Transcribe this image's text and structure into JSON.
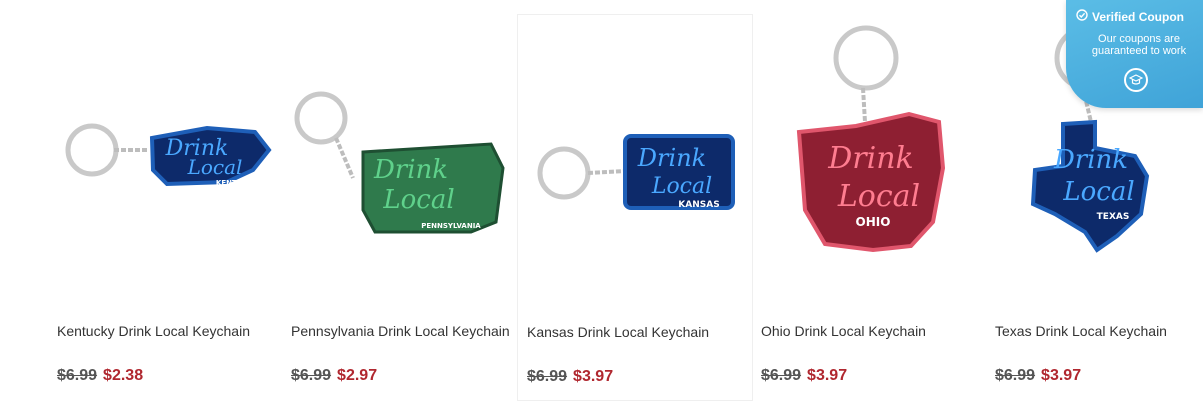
{
  "products": [
    {
      "title": "Kentucky Drink Local Keychain",
      "old_price": "$6.99",
      "new_price": "$2.38",
      "tag": "KENTUCKY"
    },
    {
      "title": "Pennsylvania Drink Local Keychain",
      "old_price": "$6.99",
      "new_price": "$2.97",
      "tag": "PENNSYLVANIA"
    },
    {
      "title": "Kansas Drink Local Keychain",
      "old_price": "$6.99",
      "new_price": "$3.97",
      "tag": "KANSAS"
    },
    {
      "title": "Ohio Drink Local Keychain",
      "old_price": "$6.99",
      "new_price": "$3.97",
      "tag": "OHIO"
    },
    {
      "title": "Texas Drink Local Keychain",
      "old_price": "$6.99",
      "new_price": "$3.97",
      "tag": "TEXAS"
    }
  ],
  "keychain_art": {
    "line1": "Drink",
    "line2": "Local"
  },
  "coupon": {
    "title": "Verified Coupon",
    "subtitle": "Our coupons are guaranteed to work",
    "icon": "graduation-cap-icon"
  },
  "colors": {
    "price_sale": "#b0272f",
    "coupon_bg": "#4ab0df",
    "blue_tag": "#0d2a6a",
    "green_tag": "#2f7a4c",
    "red_tag": "#a8243a"
  }
}
